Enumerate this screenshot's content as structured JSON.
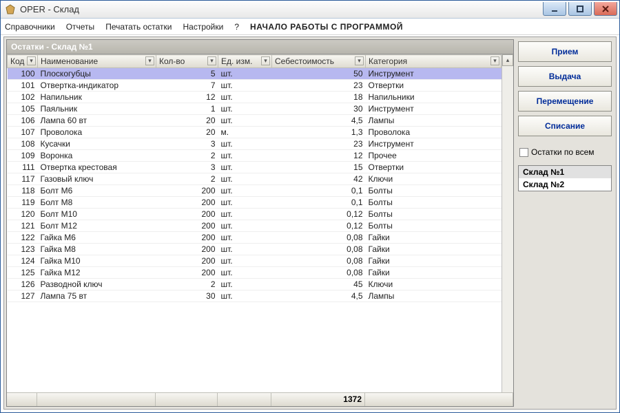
{
  "window": {
    "title": "OPER - Склад"
  },
  "menus": {
    "m1": "Справочники",
    "m2": "Отчеты",
    "m3": "Печатать остатки",
    "m4": "Настройки",
    "m5": "?",
    "start": "НАЧАЛО РАБОТЫ С ПРОГРАММОЙ"
  },
  "subheader": "Остатки - Склад №1",
  "columns": {
    "code": "Код",
    "name": "Наименование",
    "qty": "Кол-во",
    "unit": "Ед. изм.",
    "cost": "Себестоимость",
    "cat": "Категория"
  },
  "rows": [
    {
      "code": "100",
      "name": "Плоскогубцы",
      "qty": "5",
      "unit": "шт.",
      "cost": "50",
      "cat": "Инструмент",
      "sel": true
    },
    {
      "code": "101",
      "name": "Отвертка-индикатор",
      "qty": "7",
      "unit": "шт.",
      "cost": "23",
      "cat": "Отвертки"
    },
    {
      "code": "102",
      "name": "Напильник",
      "qty": "12",
      "unit": "шт.",
      "cost": "18",
      "cat": "Напильники"
    },
    {
      "code": "105",
      "name": "Паяльник",
      "qty": "1",
      "unit": "шт.",
      "cost": "30",
      "cat": "Инструмент"
    },
    {
      "code": "106",
      "name": "Лампа 60 вт",
      "qty": "20",
      "unit": "шт.",
      "cost": "4,5",
      "cat": "Лампы"
    },
    {
      "code": "107",
      "name": "Проволока",
      "qty": "20",
      "unit": "м.",
      "cost": "1,3",
      "cat": "Проволока"
    },
    {
      "code": "108",
      "name": "Кусачки",
      "qty": "3",
      "unit": "шт.",
      "cost": "23",
      "cat": "Инструмент"
    },
    {
      "code": "109",
      "name": "Воронка",
      "qty": "2",
      "unit": "шт.",
      "cost": "12",
      "cat": "Прочее"
    },
    {
      "code": "111",
      "name": "Отвертка крестовая",
      "qty": "3",
      "unit": "шт.",
      "cost": "15",
      "cat": "Отвертки"
    },
    {
      "code": "117",
      "name": "Газовый ключ",
      "qty": "2",
      "unit": "шт.",
      "cost": "42",
      "cat": "Ключи"
    },
    {
      "code": "118",
      "name": "Болт М6",
      "qty": "200",
      "unit": "шт.",
      "cost": "0,1",
      "cat": "Болты"
    },
    {
      "code": "119",
      "name": "Болт М8",
      "qty": "200",
      "unit": "шт.",
      "cost": "0,1",
      "cat": "Болты"
    },
    {
      "code": "120",
      "name": "Болт М10",
      "qty": "200",
      "unit": "шт.",
      "cost": "0,12",
      "cat": "Болты"
    },
    {
      "code": "121",
      "name": "Болт М12",
      "qty": "200",
      "unit": "шт.",
      "cost": "0,12",
      "cat": "Болты"
    },
    {
      "code": "122",
      "name": "Гайка М6",
      "qty": "200",
      "unit": "шт.",
      "cost": "0,08",
      "cat": "Гайки"
    },
    {
      "code": "123",
      "name": "Гайка М8",
      "qty": "200",
      "unit": "шт.",
      "cost": "0,08",
      "cat": "Гайки"
    },
    {
      "code": "124",
      "name": "Гайка М10",
      "qty": "200",
      "unit": "шт.",
      "cost": "0,08",
      "cat": "Гайки"
    },
    {
      "code": "125",
      "name": "Гайка М12",
      "qty": "200",
      "unit": "шт.",
      "cost": "0,08",
      "cat": "Гайки"
    },
    {
      "code": "126",
      "name": "Разводной ключ",
      "qty": "2",
      "unit": "шт.",
      "cost": "45",
      "cat": "Ключи"
    },
    {
      "code": "127",
      "name": "Лампа 75 вт",
      "qty": "30",
      "unit": "шт.",
      "cost": "4,5",
      "cat": "Лампы"
    }
  ],
  "footer": {
    "total_cost": "1372"
  },
  "buttons": {
    "b1": "Прием",
    "b2": "Выдача",
    "b3": "Перемещение",
    "b4": "Списание"
  },
  "checkbox": {
    "label": "Остатки по всем"
  },
  "warehouses": {
    "w1": "Склад №1",
    "w2": "Склад №2"
  }
}
